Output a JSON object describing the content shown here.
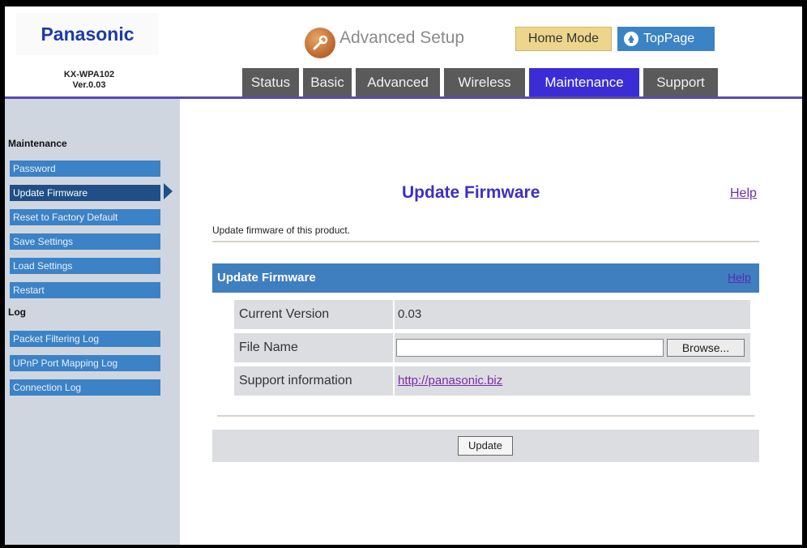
{
  "brand": {
    "logo": "Panasonic",
    "model": "KX-WPA102",
    "version": "Ver.0.03"
  },
  "header": {
    "title": "Advanced Setup",
    "home_mode": "Home Mode",
    "toppage": "TopPage",
    "tabs": [
      {
        "label": "Status",
        "active": false
      },
      {
        "label": "Basic",
        "active": false
      },
      {
        "label": "Advanced",
        "active": false
      },
      {
        "label": "Wireless",
        "active": false
      },
      {
        "label": "Maintenance",
        "active": true
      },
      {
        "label": "Support",
        "active": false
      }
    ]
  },
  "sidebar": {
    "sections": [
      {
        "title": "Maintenance",
        "items": [
          {
            "label": "Password"
          },
          {
            "label": "Update Firmware",
            "active": true
          },
          {
            "label": "Reset to Factory Default"
          },
          {
            "label": "Save Settings"
          },
          {
            "label": "Load Settings"
          },
          {
            "label": "Restart"
          }
        ]
      },
      {
        "title": "Log",
        "items": [
          {
            "label": "Packet Filtering Log"
          },
          {
            "label": "UPnP Port Mapping Log"
          },
          {
            "label": "Connection Log"
          }
        ]
      }
    ]
  },
  "main": {
    "title": "Update Firmware",
    "help": "Help",
    "description": "Update firmware of this product.",
    "panel": {
      "title": "Update Firmware",
      "help": "Help",
      "current_version_label": "Current Version",
      "current_version": "0.03",
      "file_name_label": "File Name",
      "file_name_value": "",
      "browse_label": "Browse...",
      "support_label": "Support information",
      "support_link": "http://panasonic.biz"
    },
    "update_label": "Update"
  },
  "colors": {
    "accent": "#3a2dd6",
    "panel_blue": "#3f7fc0",
    "sidebar_item": "#3c82c6",
    "sidebar_active": "#1f4f86",
    "link": "#7a2aa8"
  }
}
